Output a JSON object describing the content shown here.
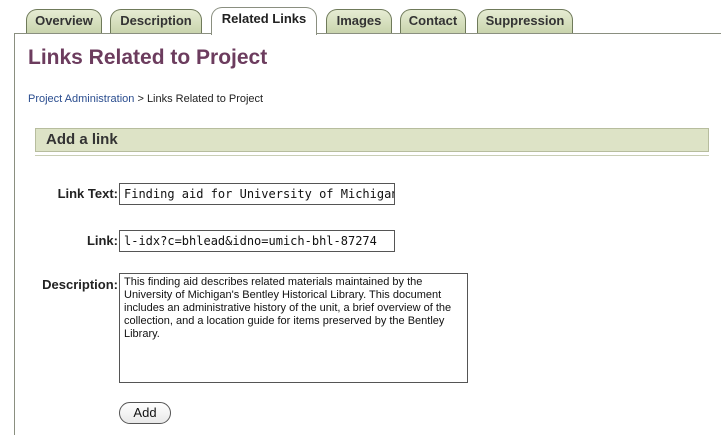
{
  "tabs": [
    {
      "label": "Overview",
      "active": false
    },
    {
      "label": "Description",
      "active": false
    },
    {
      "label": "Related Links",
      "active": true
    },
    {
      "label": "Images",
      "active": false
    },
    {
      "label": "Contact",
      "active": false
    },
    {
      "label": "Suppression",
      "active": false
    }
  ],
  "page_title": "Links Related to Project",
  "breadcrumb": {
    "parent": "Project Administration",
    "separator": " > ",
    "current": "Links Related to Project"
  },
  "section_title": "Add a link",
  "form": {
    "link_text_label": "Link Text:",
    "link_text_value": "Finding aid for University of Michigan Pro",
    "link_label": "Link:",
    "link_value": "l-idx?c=bhlead&idno=umich-bhl-87274",
    "description_label": "Description:",
    "description_value": "This finding aid describes related materials maintained by the University of Michigan's Bentley Historical Library. This document includes an administrative history of the unit, a brief overview of the collection, and a location guide for items preserved by the Bentley Library.",
    "add_button_label": "Add"
  }
}
